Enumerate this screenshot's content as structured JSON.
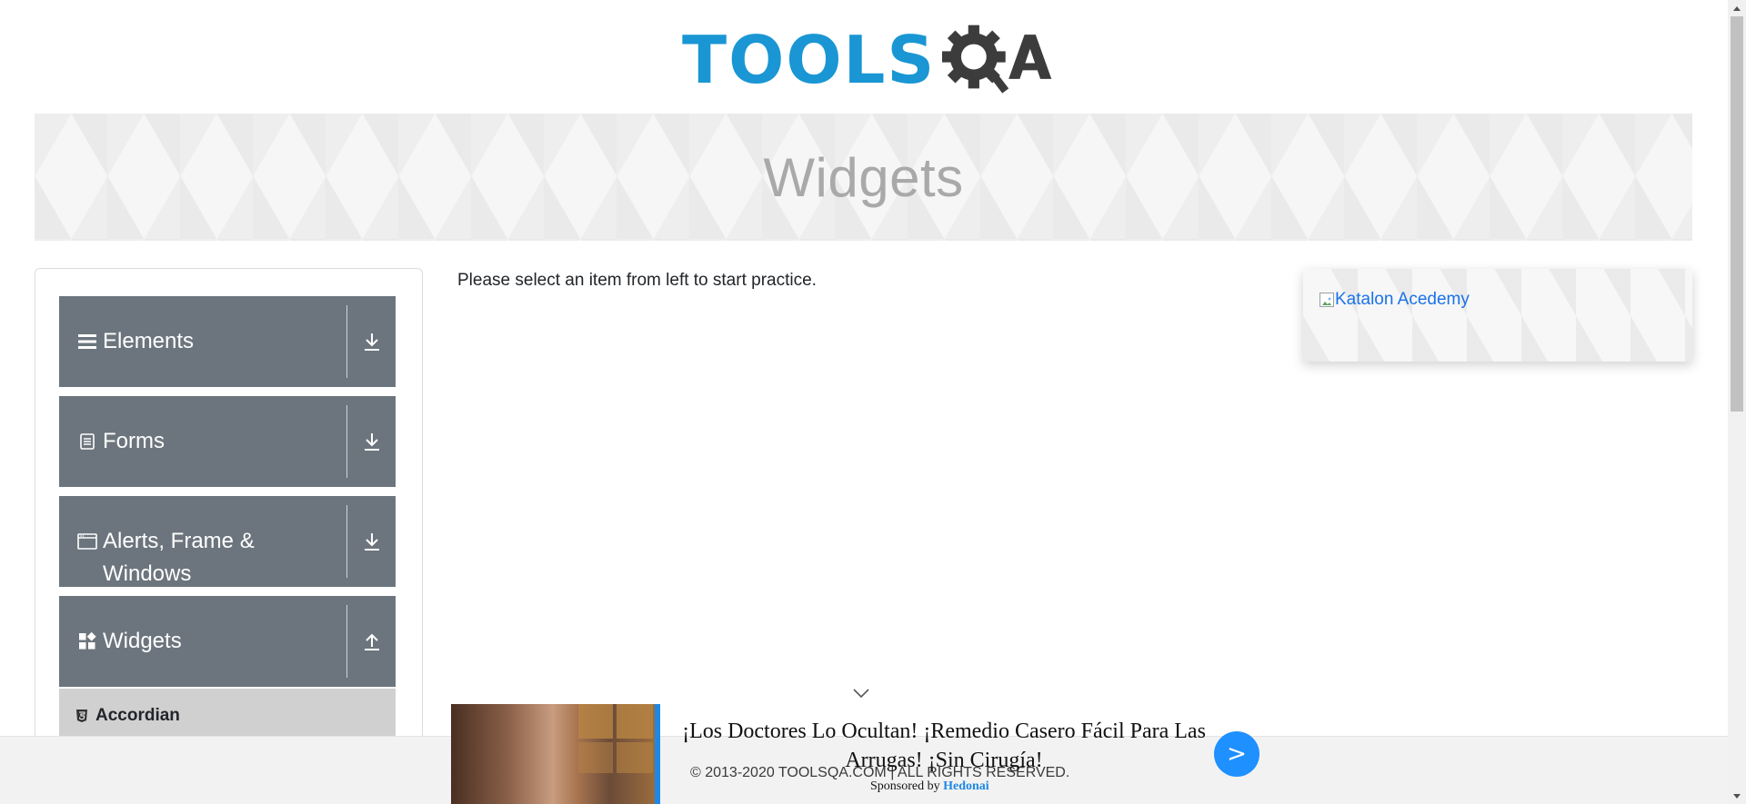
{
  "header": {
    "logo_text": "TOOLSQA"
  },
  "banner": {
    "title": "Widgets"
  },
  "sidebar": {
    "groups": [
      {
        "label": "Elements",
        "icon": "hamburger-icon",
        "toggle_icon": "download-arrow-icon",
        "expanded": false
      },
      {
        "label": "Forms",
        "icon": "document-icon",
        "toggle_icon": "download-arrow-icon",
        "expanded": false
      },
      {
        "label": "Alerts, Frame & Windows",
        "icon": "window-icon",
        "toggle_icon": "download-arrow-icon",
        "expanded": false
      },
      {
        "label": "Widgets",
        "icon": "widgets-icon",
        "toggle_icon": "upload-arrow-icon",
        "expanded": true
      }
    ],
    "widgets_items": [
      {
        "label": "Accordian",
        "icon": "html5-icon"
      }
    ]
  },
  "main": {
    "intro": "Please select an item from left to start practice."
  },
  "right_ad": {
    "alt_text": "Katalon Acedemy",
    "icon": "broken-image-icon"
  },
  "footer": {
    "text": "© 2013-2020 TOOLSQA.COM | ALL RIGHTS RESERVED."
  },
  "bottom_ad": {
    "headline": "¡Los Doctores Lo Ocultan! ¡Remedio Casero Fácil Para Las Arrugas! ¡Sin Cirugía!",
    "next_label": ">",
    "sponsored_prefix": "Sponsored by",
    "sponsor": "Hedonai"
  },
  "colors": {
    "brand_blue": "#1996d3",
    "brand_dark": "#3c3c3c",
    "sidebar_group": "#6c757d",
    "link": "#1a73e8",
    "ad_button": "#1e90ff"
  }
}
